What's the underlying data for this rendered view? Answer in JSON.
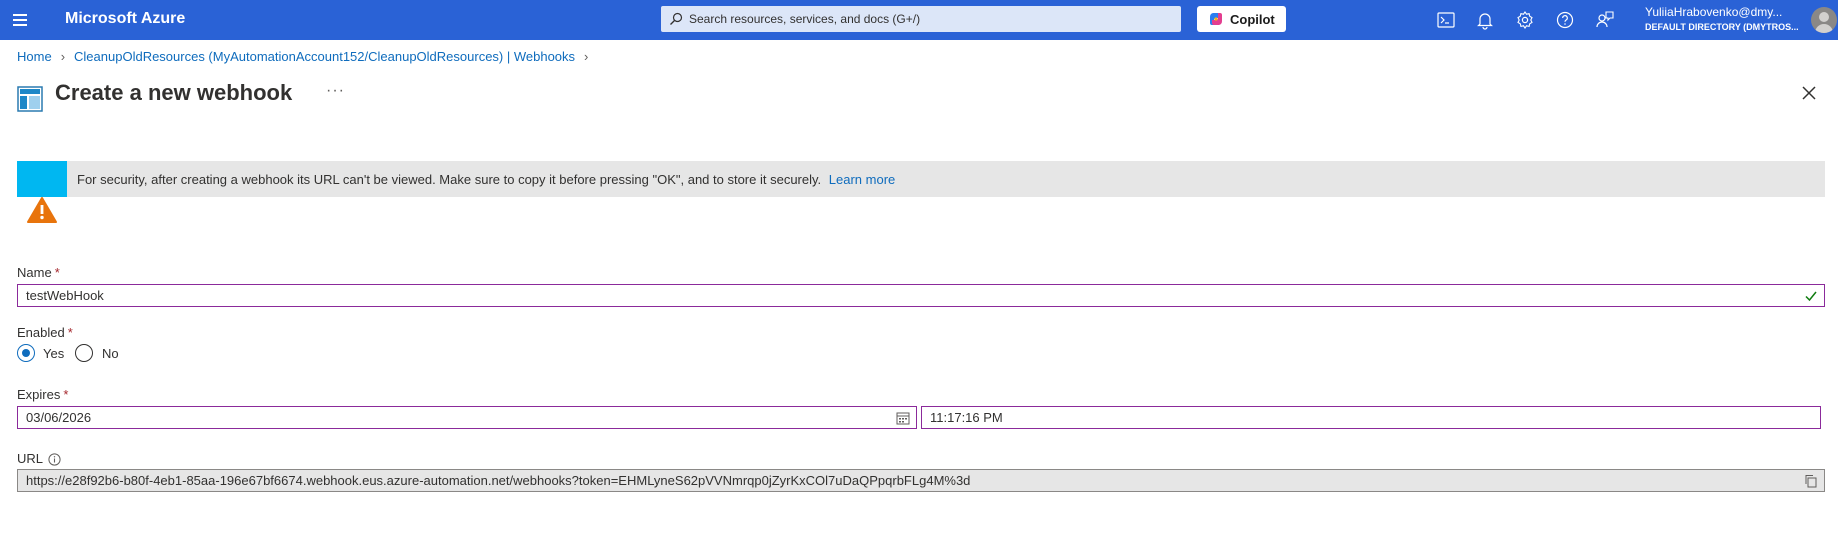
{
  "topbar": {
    "brand": "Microsoft Azure",
    "search_placeholder": "Search resources, services, and docs (G+/)",
    "copilot_label": "Copilot",
    "icons": [
      "cloud-shell-icon",
      "bell-icon",
      "gear-icon",
      "help-icon",
      "feedback-icon"
    ],
    "account_name": "YuliiaHrabovenko@dmy...",
    "account_directory": "DEFAULT DIRECTORY (DMYTROS..."
  },
  "breadcrumb": {
    "items": [
      "Home",
      "CleanupOldResources (MyAutomationAccount152/CleanupOldResources) | Webhooks"
    ]
  },
  "page": {
    "title": "Create a new webhook",
    "more": "···"
  },
  "banner": {
    "text": "For security, after creating a webhook its URL can't be viewed. Make sure to copy it before pressing \"OK\", and to store it securely.",
    "link": "Learn more"
  },
  "form": {
    "name_label": "Name",
    "name_value": "testWebHook",
    "enabled_label": "Enabled",
    "enabled_yes": "Yes",
    "enabled_no": "No",
    "enabled_selected": "Yes",
    "expires_label": "Expires",
    "expires_date": "03/06/2026",
    "expires_time": "11:17:16 PM",
    "url_label": "URL",
    "url_value": "https://e28f92b6-b80f-4eb1-85aa-196e67bf6674.webhook.eus.azure-automation.net/webhooks?token=EHMLyneS62pVVNmrqp0jZyrKxCOl7uDaQPpqrbFLg4M%3d",
    "required_mark": "*"
  },
  "colors": {
    "topbar": "#2a62d6",
    "link": "#0f6cbd",
    "banner_accent": "#00b7f1",
    "warning": "#e8740c",
    "focus_border": "#8b2a9b",
    "success": "#107c10"
  }
}
